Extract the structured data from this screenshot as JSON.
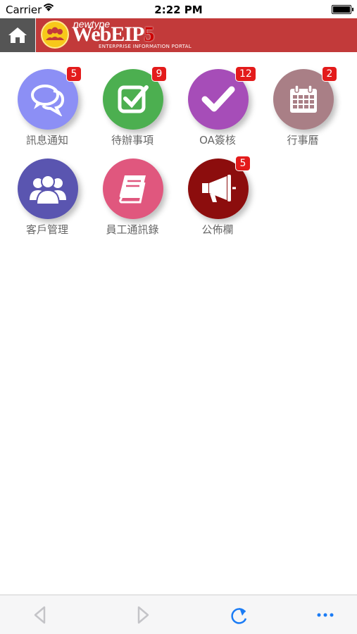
{
  "status_bar": {
    "carrier": "Carrier",
    "time": "2:22 PM"
  },
  "header": {
    "logo_small": "newtype",
    "logo_main": "WebEIP",
    "logo_number": "5",
    "logo_sub": "ENTERPRISE INFORMATION PORTAL"
  },
  "tiles": [
    {
      "label": "訊息通知",
      "badge": "5",
      "color": "#8c8ff5",
      "icon": "chat-icon"
    },
    {
      "label": "待辦事項",
      "badge": "9",
      "color": "#4caf50",
      "icon": "checkbox-icon"
    },
    {
      "label": "OA簽核",
      "badge": "12",
      "color": "#a64db8",
      "icon": "check-icon"
    },
    {
      "label": "行事曆",
      "badge": "2",
      "color": "#a97f86",
      "icon": "calendar-icon"
    },
    {
      "label": "客戶管理",
      "badge": "",
      "color": "#5a55b0",
      "icon": "group-icon"
    },
    {
      "label": "員工通訊錄",
      "badge": "",
      "color": "#e0577e",
      "icon": "book-icon"
    },
    {
      "label": "公佈欄",
      "badge": "5",
      "color": "#8c0d0d",
      "icon": "megaphone-icon"
    }
  ],
  "toolbar": {
    "items": [
      "back-icon",
      "forward-icon",
      "refresh-icon",
      "more-icon"
    ]
  }
}
